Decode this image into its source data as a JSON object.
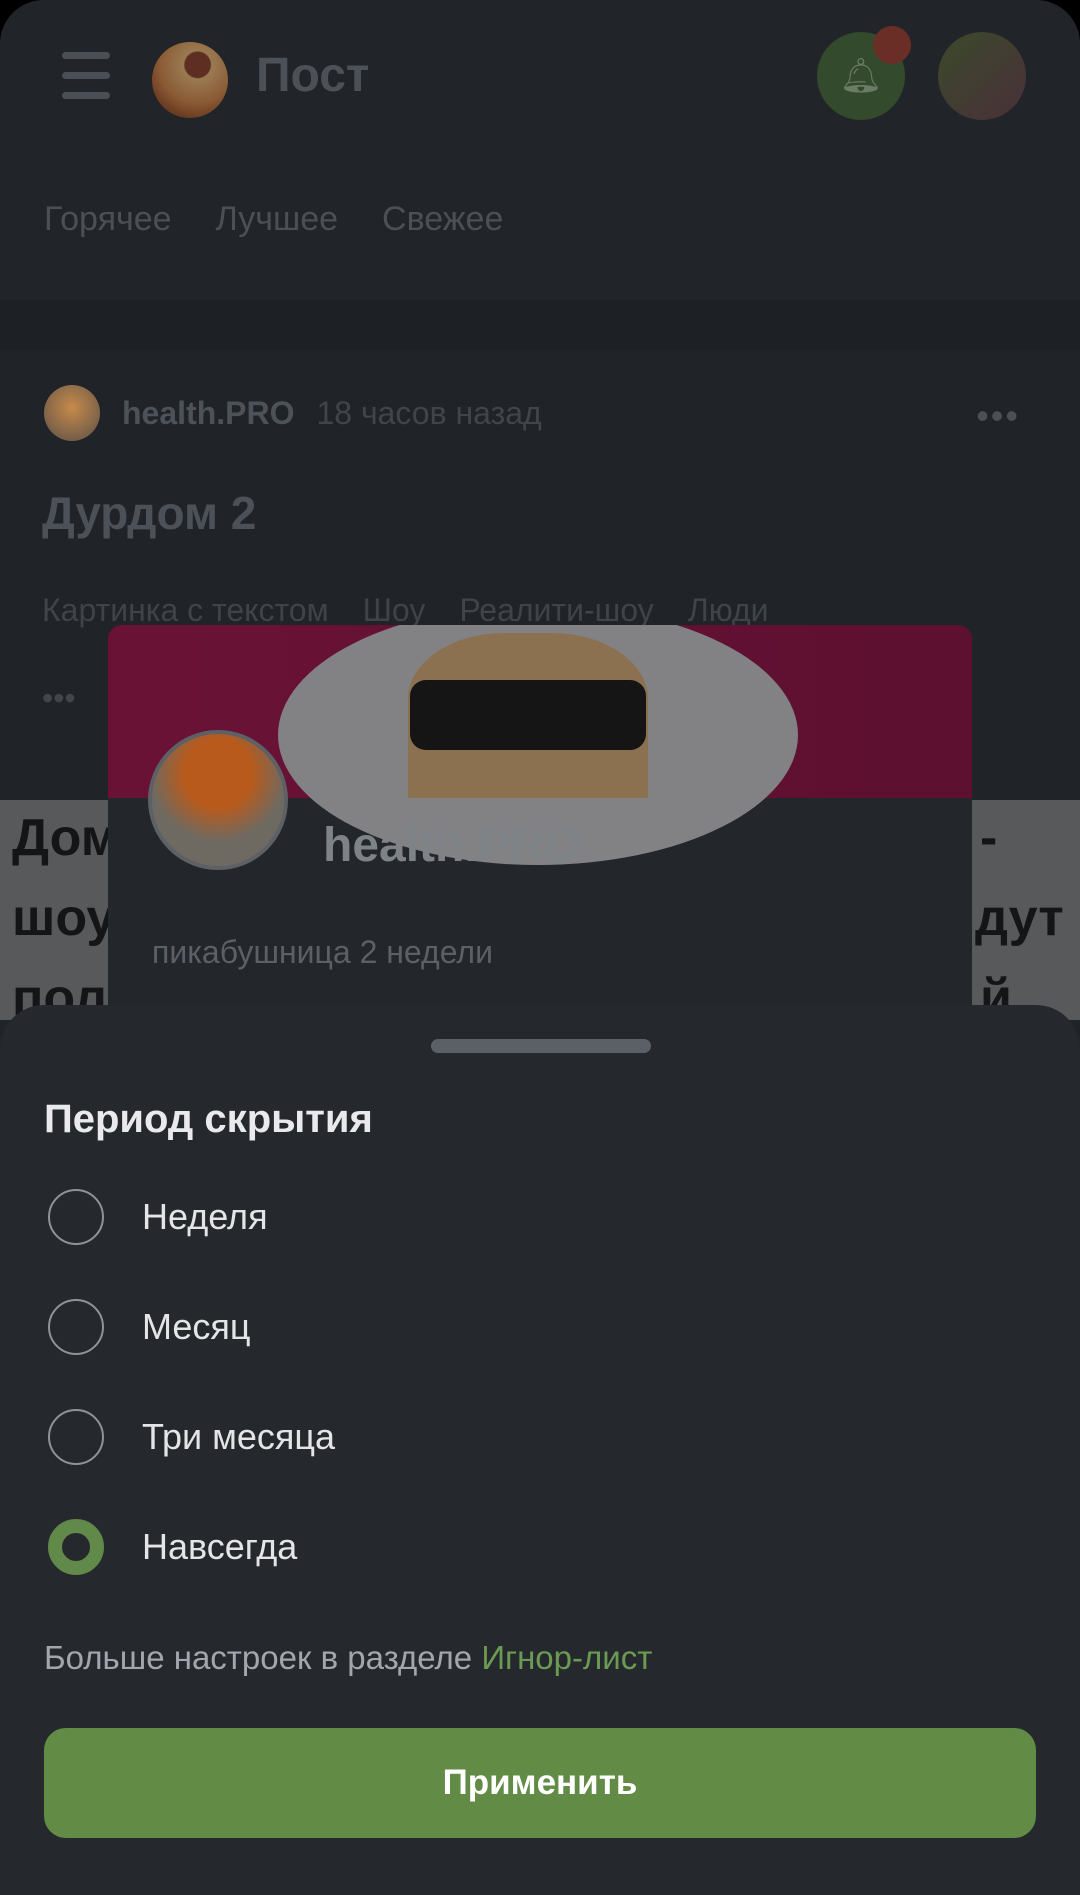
{
  "header": {
    "title": "Пост",
    "menu_icon": "hamburger-icon",
    "notification_icon": "bell-icon"
  },
  "tabs": [
    "Горячее",
    "Лучшее",
    "Свежее"
  ],
  "post": {
    "author": "health.PRO",
    "time": "18 часов назад",
    "title": "Дурдом 2",
    "tags": [
      "Картинка с текстом",
      "Шоу",
      "Реалити-шоу",
      "Люди"
    ],
    "more": "•••",
    "image_text": [
      "Дом",
      "-",
      "шоу",
      "дут",
      "пол",
      "й."
    ]
  },
  "profile_card": {
    "name": "health.PRO",
    "subtitle": "пикабушница 2 недели"
  },
  "sheet": {
    "title": "Период скрытия",
    "options": [
      "Неделя",
      "Месяц",
      "Три месяца",
      "Навсегда"
    ],
    "selected": "Навсегда",
    "footer_text": "Больше настроек в разделе ",
    "footer_link": "Игнор-лист",
    "apply": "Применить"
  },
  "colors": {
    "accent": "#628c46",
    "sheet_bg": "#25292e",
    "link": "#6b9a52"
  }
}
